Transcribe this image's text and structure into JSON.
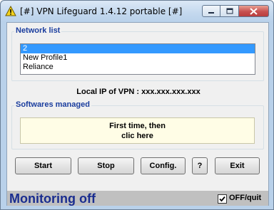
{
  "window": {
    "title": "[#] VPN Lifeguard 1.4.12 portable [#]",
    "icon": "warning-icon"
  },
  "title_buttons": {
    "minimize_icon": "minimize-icon",
    "maximize_icon": "maximize-icon",
    "close_icon": "close-icon"
  },
  "network": {
    "label": "Network list",
    "items": [
      "2",
      "New Profile1",
      "Reliance"
    ],
    "selected_index": 0
  },
  "local_ip": "Local IP of VPN : xxx.xxx.xxx.xxx",
  "softwares": {
    "label": "Softwares managed",
    "notice_line1": "First time, then",
    "notice_line2": "clic here"
  },
  "buttons": {
    "start": "Start",
    "stop": "Stop",
    "config": "Config.",
    "help": "?",
    "exit": "Exit"
  },
  "status": {
    "text": "Monitoring off",
    "off_quit_label": "OFF/quit",
    "off_quit_checked": true
  },
  "colors": {
    "accent_label": "#1a3d9e",
    "selected_bg": "#3399ff",
    "status_text": "#1a2d8f",
    "close_button": "#c75050"
  }
}
